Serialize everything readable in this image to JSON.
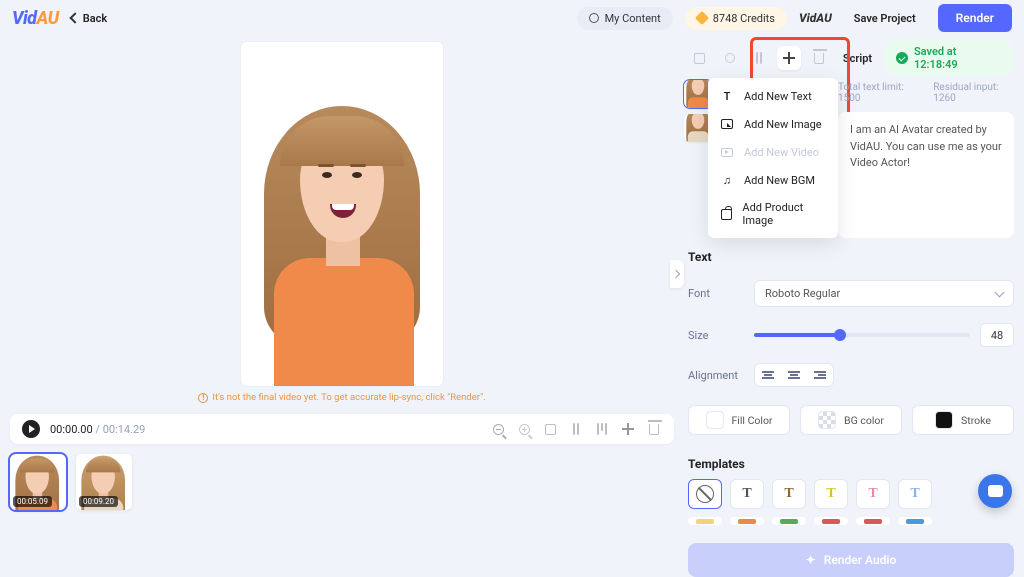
{
  "header": {
    "logo_main": "Vid",
    "logo_accent": "AU",
    "back": "Back",
    "my_content": "My Content",
    "credits": "8748 Credits",
    "save": "Save Project",
    "render": "Render"
  },
  "canvas": {
    "warning": "It's not the final video yet. To get accurate lip-sync, click \"Render\"."
  },
  "player": {
    "current": "00:00.00",
    "duration": "00:14.29"
  },
  "thumbs": [
    {
      "time": "00:05.09"
    },
    {
      "time": "00:09.20"
    }
  ],
  "add_menu": {
    "text": "Add New Text",
    "image": "Add New Image",
    "video": "Add New Video",
    "bgm": "Add New BGM",
    "product": "Add Product Image"
  },
  "right": {
    "script_tab": "Script",
    "saved": "Saved at 12:18:49",
    "limit_total_label": "Total text limit:",
    "limit_total_val": "1500",
    "limit_resid_label": "Residual input:",
    "limit_resid_val": "1260",
    "script_text": "I am an AI Avatar created by VidAU. You can use me as your Video Actor!",
    "text_title": "Text",
    "font_label": "Font",
    "font_value": "Roboto Regular",
    "size_label": "Size",
    "size_value": "48",
    "align_label": "Alignment",
    "fill": "Fill Color",
    "bg": "BG color",
    "stroke": "Stroke",
    "templates_title": "Templates",
    "render_audio": "Render Audio"
  }
}
